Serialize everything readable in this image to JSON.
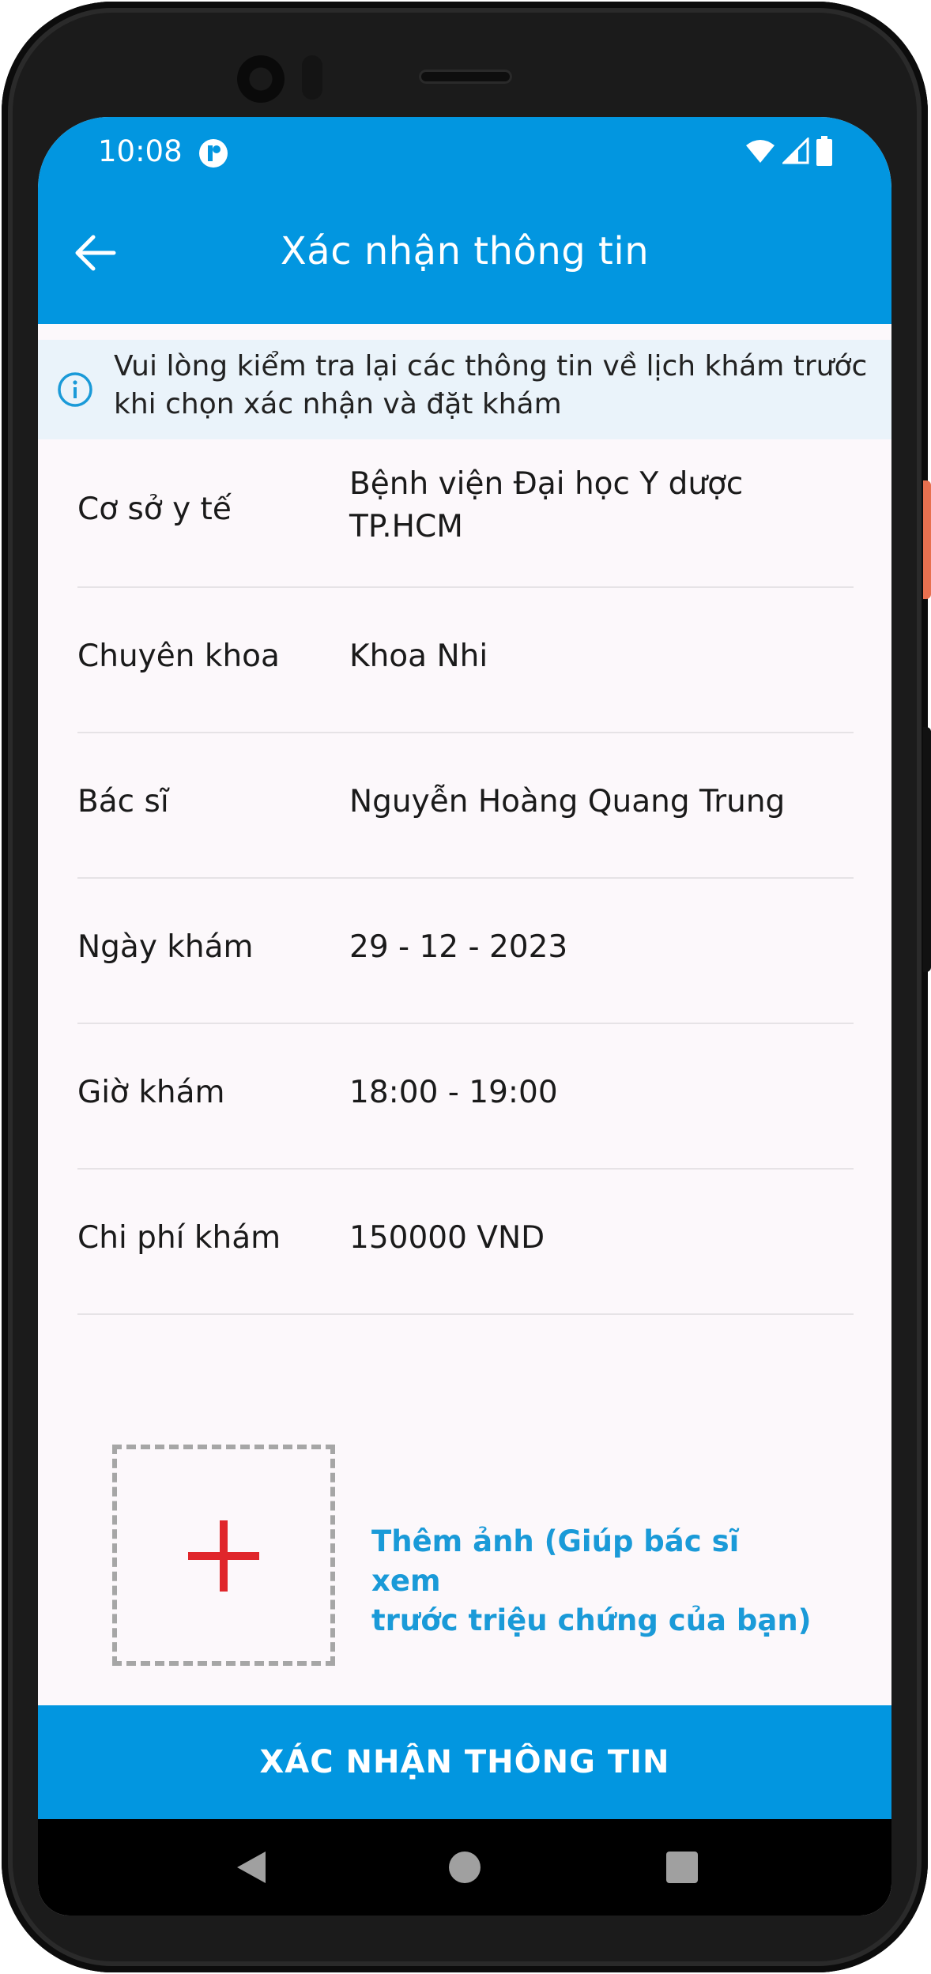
{
  "status_bar": {
    "time": "10:08"
  },
  "app_bar": {
    "title": "Xác nhận thông tin",
    "back_icon": "arrow-left-icon"
  },
  "notice": {
    "icon": "info-icon",
    "text": "Vui lòng kiểm tra lại các thông tin về lịch khám trước\nkhi chọn xác nhận và đặt khám"
  },
  "details": [
    {
      "label": "Cơ sở y tế",
      "value": "Bệnh viện Đại học Y dược\nTP.HCM"
    },
    {
      "label": "Chuyên khoa",
      "value": "Khoa Nhi"
    },
    {
      "label": "Bác sĩ",
      "value": "Nguyễn Hoàng Quang Trung"
    },
    {
      "label": "Ngày khám",
      "value": "29 - 12 - 2023"
    },
    {
      "label": "Giờ khám",
      "value": "18:00 - 19:00"
    },
    {
      "label": "Chi phí khám",
      "value": "150000 VND"
    }
  ],
  "add_photo": {
    "icon": "plus-icon",
    "text": "Thêm ảnh (Giúp bác sĩ xem\ntrước triệu chứng của bạn)"
  },
  "confirm_button": {
    "label": "XÁC NHẬN THÔNG TIN"
  },
  "colors": {
    "primary": "#0296e0",
    "accent_text": "#1a9ad8",
    "plus": "#e0262b",
    "background": "#fcf8fb",
    "notice_bg": "#eaf3fa"
  }
}
